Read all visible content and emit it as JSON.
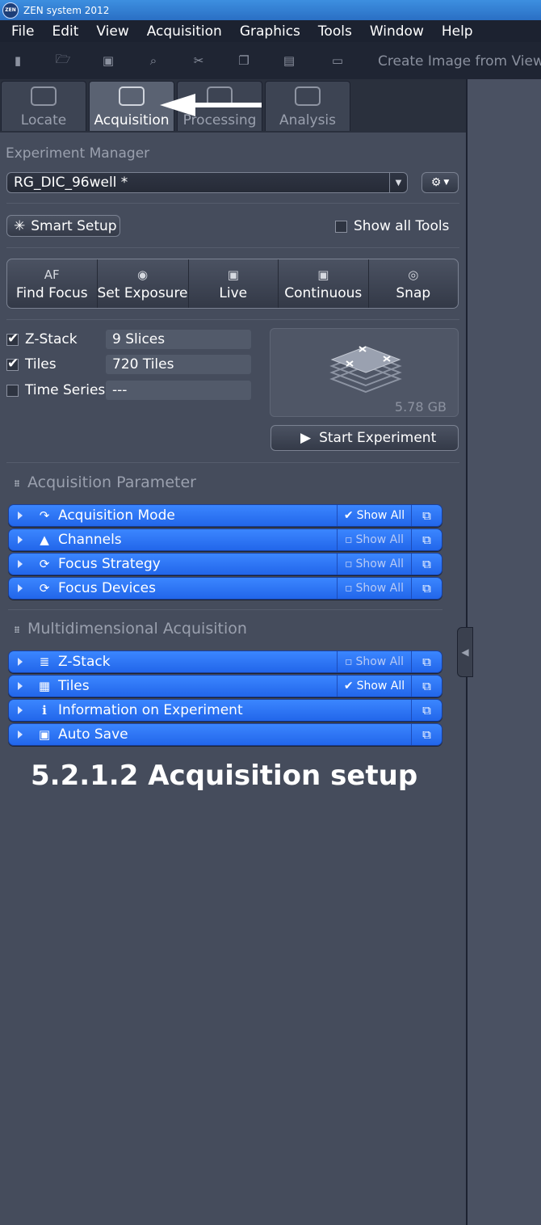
{
  "titlebar": {
    "logo": "ZEN",
    "title": "ZEN system 2012"
  },
  "menu": [
    "File",
    "Edit",
    "View",
    "Acquisition",
    "Graphics",
    "Tools",
    "Window",
    "Help"
  ],
  "toolbar": {
    "icons": [
      "new-document-icon",
      "open-folder-icon",
      "save-icon",
      "print-preview-icon",
      "cut-icon",
      "copy-icon",
      "paste-icon",
      "ruler-icon"
    ],
    "create_image_label": "Create Image from View"
  },
  "tabs": [
    {
      "label": "Locate",
      "icon": "eye-icon",
      "active": false
    },
    {
      "label": "Acquisition",
      "icon": "acquisition-icon",
      "active": true
    },
    {
      "label": "Processing",
      "icon": "processing-gear-icon",
      "active": false
    },
    {
      "label": "Analysis",
      "icon": "histogram-icon",
      "active": false
    }
  ],
  "experiment": {
    "section_label": "Experiment Manager",
    "selected": "RG_DIC_96well *"
  },
  "smart_setup": {
    "label": "Smart Setup",
    "show_all_tools": "Show all Tools",
    "show_all_checked": false
  },
  "actions": [
    {
      "icon_text": "AF",
      "label": "Find Focus"
    },
    {
      "icon": "camera-icon",
      "label": "Set Exposure"
    },
    {
      "icon": "live-video-icon",
      "label": "Live"
    },
    {
      "icon": "continuous-video-icon",
      "label": "Continuous"
    },
    {
      "icon": "snap-camera-icon",
      "label": "Snap"
    }
  ],
  "dimensions": [
    {
      "label": "Z-Stack",
      "checked": true,
      "value": "9 Slices"
    },
    {
      "label": "Tiles",
      "checked": true,
      "value": "720 Tiles"
    },
    {
      "label": "Time Series",
      "checked": false,
      "value": "---"
    }
  ],
  "preview": {
    "size": "5.78 GB"
  },
  "start_button": "Start Experiment",
  "acq_param": {
    "title": "Acquisition Parameter",
    "items": [
      {
        "label": "Acquisition Mode",
        "icon": "acquisition-mode-icon",
        "show_all": "Show All",
        "show_all_checked": true
      },
      {
        "label": "Channels",
        "icon": "channels-icon",
        "show_all": "Show All",
        "show_all_checked": false
      },
      {
        "label": "Focus Strategy",
        "icon": "focus-strategy-icon",
        "show_all": "Show All",
        "show_all_checked": false
      },
      {
        "label": "Focus Devices",
        "icon": "focus-devices-icon",
        "show_all": "Show All",
        "show_all_checked": false
      }
    ]
  },
  "multidim": {
    "title": "Multidimensional Acquisition",
    "items": [
      {
        "label": "Z-Stack",
        "icon": "z-stack-icon",
        "show_all": "Show All",
        "show_all_checked": false
      },
      {
        "label": "Tiles",
        "icon": "tiles-icon",
        "show_all": "Show All",
        "show_all_checked": true
      },
      {
        "label": "Information on Experiment",
        "icon": "info-icon",
        "show_all": "",
        "show_all_checked": false
      },
      {
        "label": "Auto Save",
        "icon": "save-disk-icon",
        "show_all": "",
        "show_all_checked": false
      }
    ]
  },
  "caption": "5.2.1.2 Acquisition setup",
  "colors": {
    "accent": "#2d74f5",
    "panel": "#454c5c",
    "menubar": "#1c2230"
  }
}
